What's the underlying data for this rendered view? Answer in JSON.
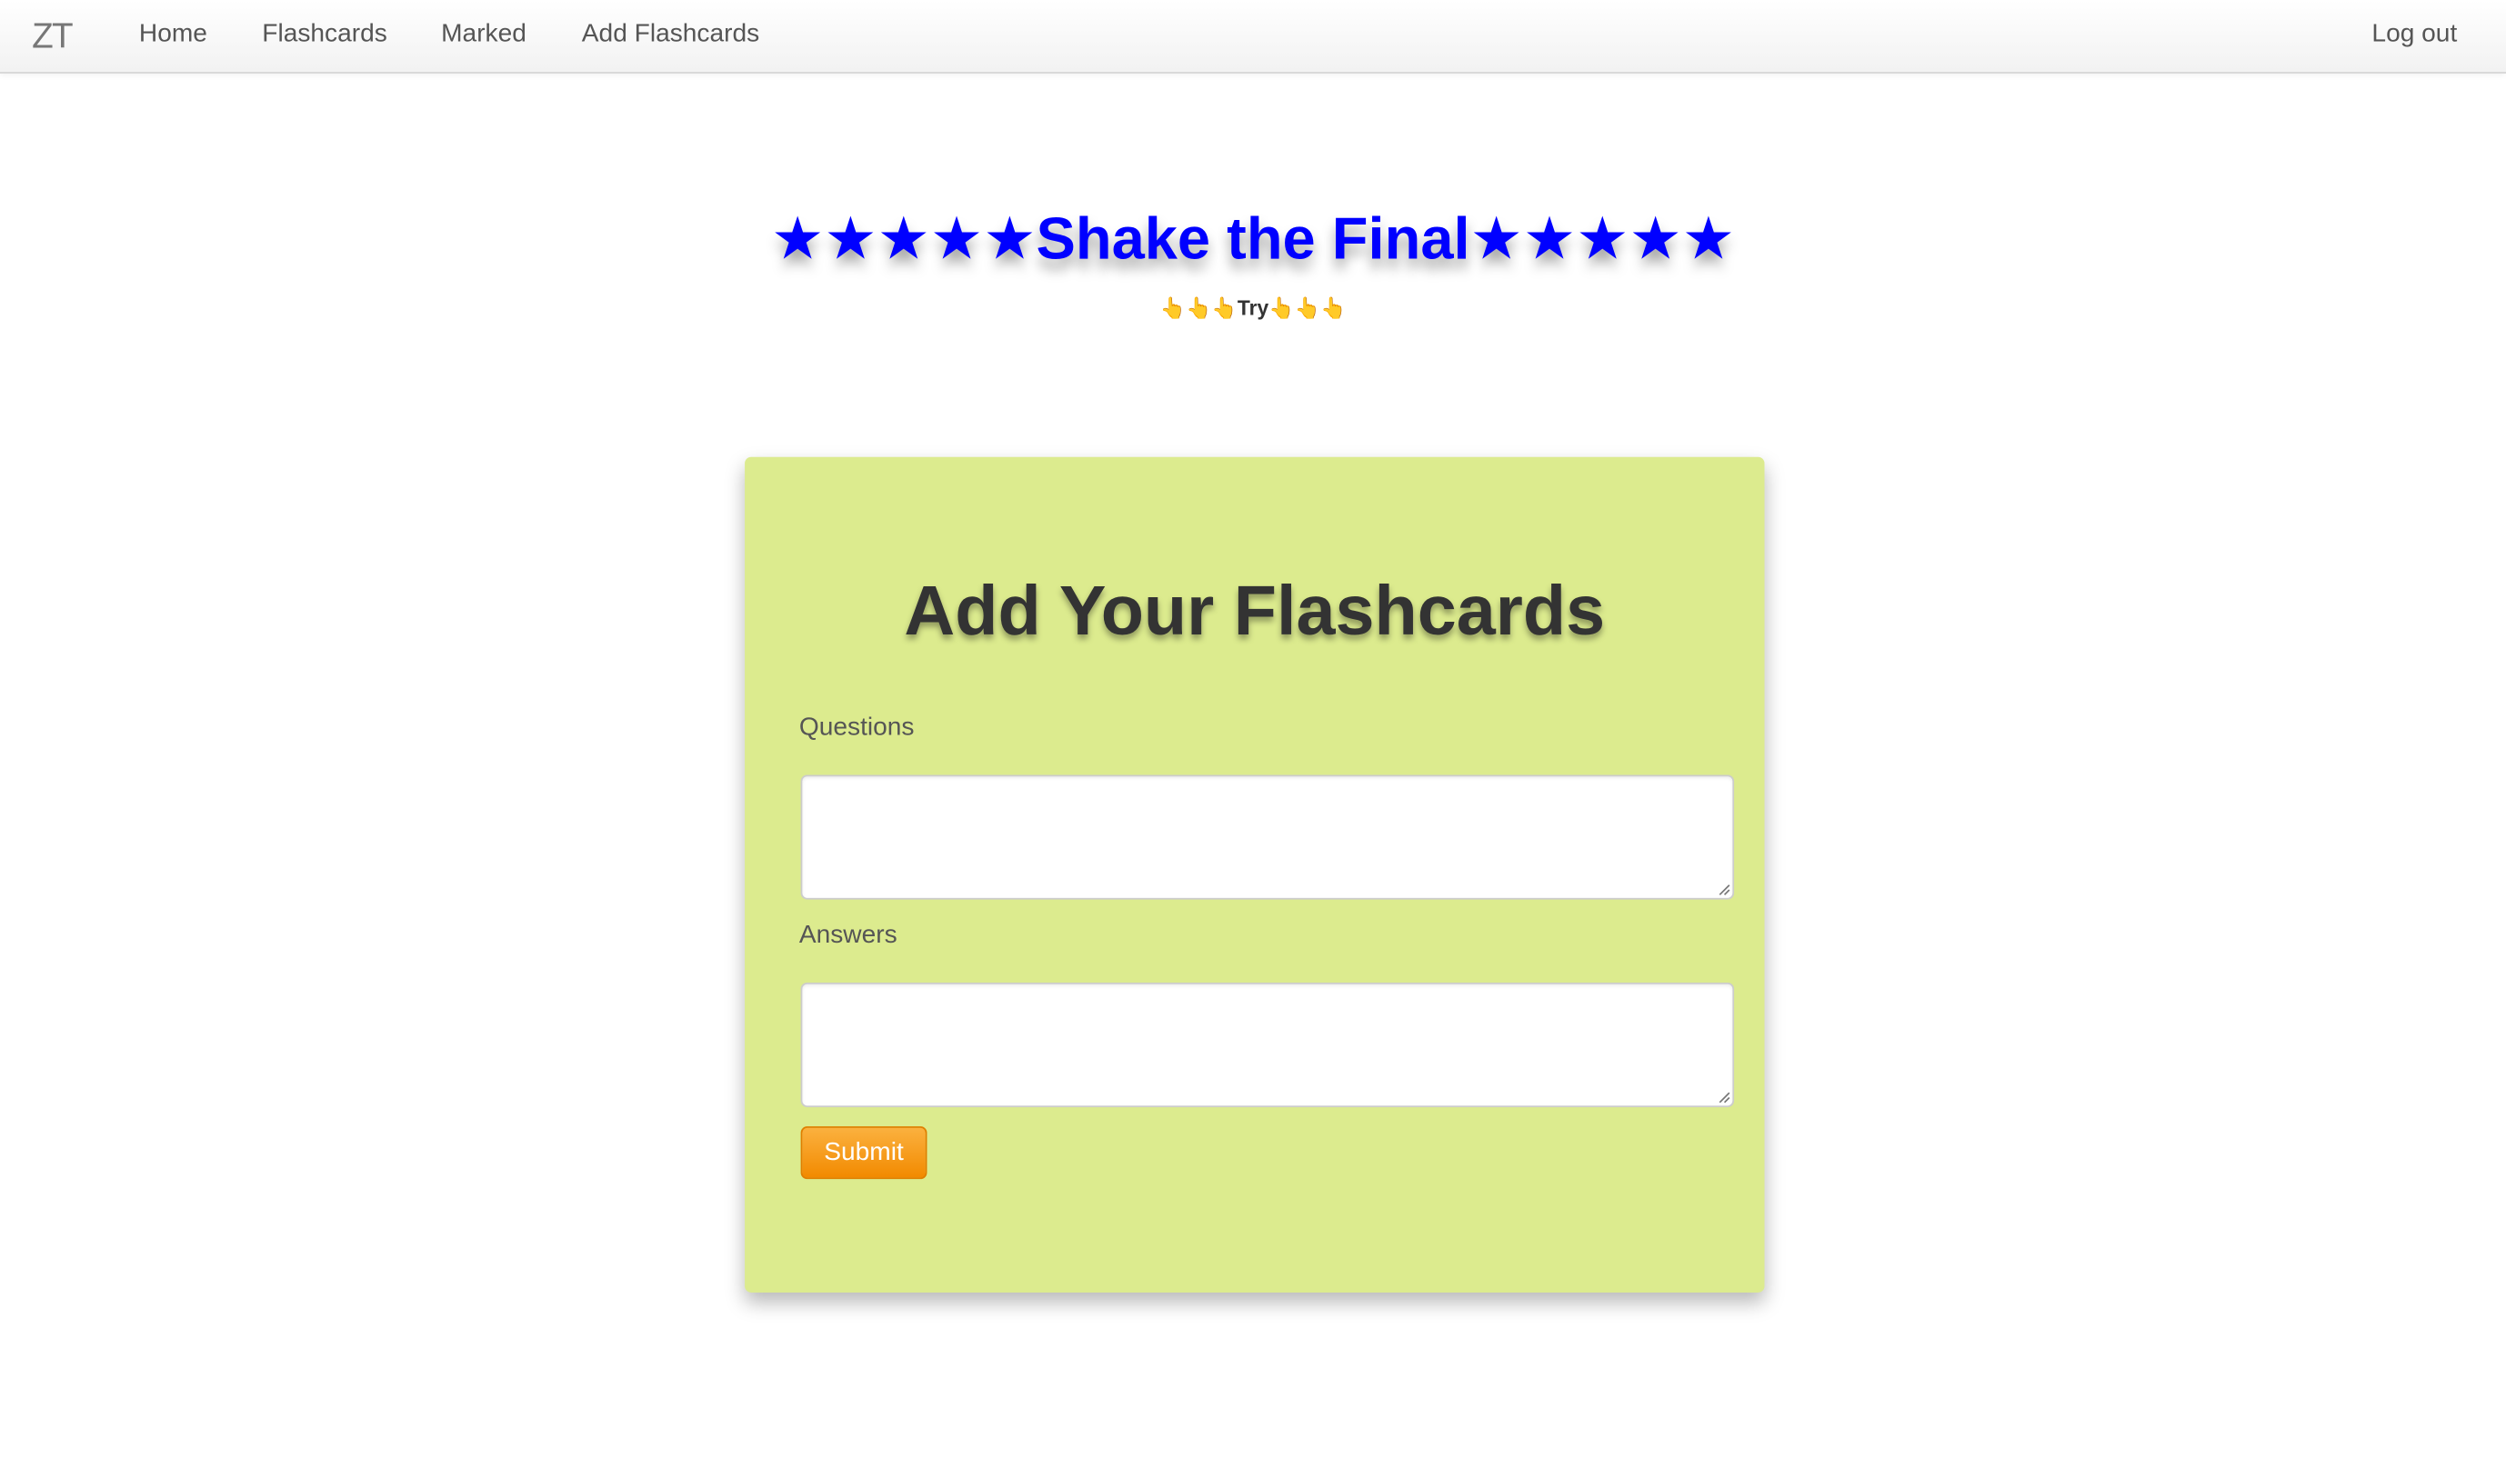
{
  "navbar": {
    "brand": "ZT",
    "links": {
      "home": "Home",
      "flashcards": "Flashcards",
      "marked": "Marked",
      "add_flashcards": "Add Flashcards"
    },
    "logout": "Log out"
  },
  "hero": {
    "title": "★★★★★Shake the Final★★★★★",
    "subtitle": "👆👆👆Try👆👆👆",
    "title_color": "#0000ff"
  },
  "form": {
    "title": "Add Your Flashcards",
    "questions_label": "Questions",
    "questions_value": "",
    "answers_label": "Answers",
    "answers_value": "",
    "submit_label": "Submit",
    "card_color": "#dceb8e",
    "submit_color": "#f5a020"
  }
}
